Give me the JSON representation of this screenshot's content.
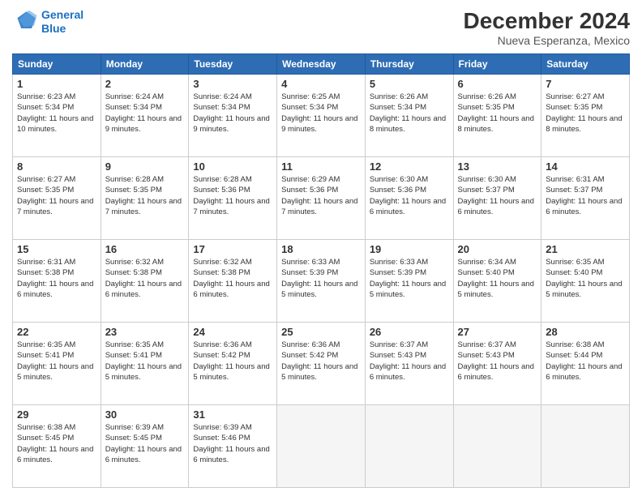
{
  "header": {
    "logo_line1": "General",
    "logo_line2": "Blue",
    "title": "December 2024",
    "subtitle": "Nueva Esperanza, Mexico"
  },
  "columns": [
    "Sunday",
    "Monday",
    "Tuesday",
    "Wednesday",
    "Thursday",
    "Friday",
    "Saturday"
  ],
  "weeks": [
    [
      {
        "day": "1",
        "info": "Sunrise: 6:23 AM\nSunset: 5:34 PM\nDaylight: 11 hours and 10 minutes."
      },
      {
        "day": "2",
        "info": "Sunrise: 6:24 AM\nSunset: 5:34 PM\nDaylight: 11 hours and 9 minutes."
      },
      {
        "day": "3",
        "info": "Sunrise: 6:24 AM\nSunset: 5:34 PM\nDaylight: 11 hours and 9 minutes."
      },
      {
        "day": "4",
        "info": "Sunrise: 6:25 AM\nSunset: 5:34 PM\nDaylight: 11 hours and 9 minutes."
      },
      {
        "day": "5",
        "info": "Sunrise: 6:26 AM\nSunset: 5:34 PM\nDaylight: 11 hours and 8 minutes."
      },
      {
        "day": "6",
        "info": "Sunrise: 6:26 AM\nSunset: 5:35 PM\nDaylight: 11 hours and 8 minutes."
      },
      {
        "day": "7",
        "info": "Sunrise: 6:27 AM\nSunset: 5:35 PM\nDaylight: 11 hours and 8 minutes."
      }
    ],
    [
      {
        "day": "8",
        "info": "Sunrise: 6:27 AM\nSunset: 5:35 PM\nDaylight: 11 hours and 7 minutes."
      },
      {
        "day": "9",
        "info": "Sunrise: 6:28 AM\nSunset: 5:35 PM\nDaylight: 11 hours and 7 minutes."
      },
      {
        "day": "10",
        "info": "Sunrise: 6:28 AM\nSunset: 5:36 PM\nDaylight: 11 hours and 7 minutes."
      },
      {
        "day": "11",
        "info": "Sunrise: 6:29 AM\nSunset: 5:36 PM\nDaylight: 11 hours and 7 minutes."
      },
      {
        "day": "12",
        "info": "Sunrise: 6:30 AM\nSunset: 5:36 PM\nDaylight: 11 hours and 6 minutes."
      },
      {
        "day": "13",
        "info": "Sunrise: 6:30 AM\nSunset: 5:37 PM\nDaylight: 11 hours and 6 minutes."
      },
      {
        "day": "14",
        "info": "Sunrise: 6:31 AM\nSunset: 5:37 PM\nDaylight: 11 hours and 6 minutes."
      }
    ],
    [
      {
        "day": "15",
        "info": "Sunrise: 6:31 AM\nSunset: 5:38 PM\nDaylight: 11 hours and 6 minutes."
      },
      {
        "day": "16",
        "info": "Sunrise: 6:32 AM\nSunset: 5:38 PM\nDaylight: 11 hours and 6 minutes."
      },
      {
        "day": "17",
        "info": "Sunrise: 6:32 AM\nSunset: 5:38 PM\nDaylight: 11 hours and 6 minutes."
      },
      {
        "day": "18",
        "info": "Sunrise: 6:33 AM\nSunset: 5:39 PM\nDaylight: 11 hours and 5 minutes."
      },
      {
        "day": "19",
        "info": "Sunrise: 6:33 AM\nSunset: 5:39 PM\nDaylight: 11 hours and 5 minutes."
      },
      {
        "day": "20",
        "info": "Sunrise: 6:34 AM\nSunset: 5:40 PM\nDaylight: 11 hours and 5 minutes."
      },
      {
        "day": "21",
        "info": "Sunrise: 6:35 AM\nSunset: 5:40 PM\nDaylight: 11 hours and 5 minutes."
      }
    ],
    [
      {
        "day": "22",
        "info": "Sunrise: 6:35 AM\nSunset: 5:41 PM\nDaylight: 11 hours and 5 minutes."
      },
      {
        "day": "23",
        "info": "Sunrise: 6:35 AM\nSunset: 5:41 PM\nDaylight: 11 hours and 5 minutes."
      },
      {
        "day": "24",
        "info": "Sunrise: 6:36 AM\nSunset: 5:42 PM\nDaylight: 11 hours and 5 minutes."
      },
      {
        "day": "25",
        "info": "Sunrise: 6:36 AM\nSunset: 5:42 PM\nDaylight: 11 hours and 5 minutes."
      },
      {
        "day": "26",
        "info": "Sunrise: 6:37 AM\nSunset: 5:43 PM\nDaylight: 11 hours and 6 minutes."
      },
      {
        "day": "27",
        "info": "Sunrise: 6:37 AM\nSunset: 5:43 PM\nDaylight: 11 hours and 6 minutes."
      },
      {
        "day": "28",
        "info": "Sunrise: 6:38 AM\nSunset: 5:44 PM\nDaylight: 11 hours and 6 minutes."
      }
    ],
    [
      {
        "day": "29",
        "info": "Sunrise: 6:38 AM\nSunset: 5:45 PM\nDaylight: 11 hours and 6 minutes."
      },
      {
        "day": "30",
        "info": "Sunrise: 6:39 AM\nSunset: 5:45 PM\nDaylight: 11 hours and 6 minutes."
      },
      {
        "day": "31",
        "info": "Sunrise: 6:39 AM\nSunset: 5:46 PM\nDaylight: 11 hours and 6 minutes."
      },
      null,
      null,
      null,
      null
    ]
  ]
}
